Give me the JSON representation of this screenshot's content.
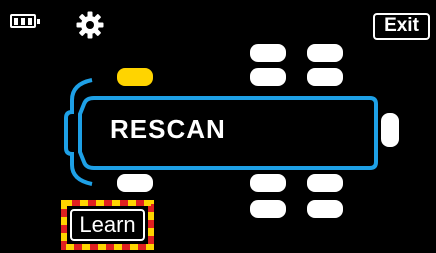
{
  "status_bar": {
    "battery_icon": "battery-icon",
    "settings_icon": "gear-icon",
    "exit_label": "Exit"
  },
  "vehicle": {
    "outline_color": "#1ea0e6",
    "tire_color_default": "#ffffff",
    "tire_color_selected": "#ffd400",
    "selected_tire": "front-left",
    "status_text": "RESCAN"
  },
  "learn": {
    "label": "Learn",
    "highlight_colors": [
      "#e02020",
      "#ffd400"
    ]
  }
}
